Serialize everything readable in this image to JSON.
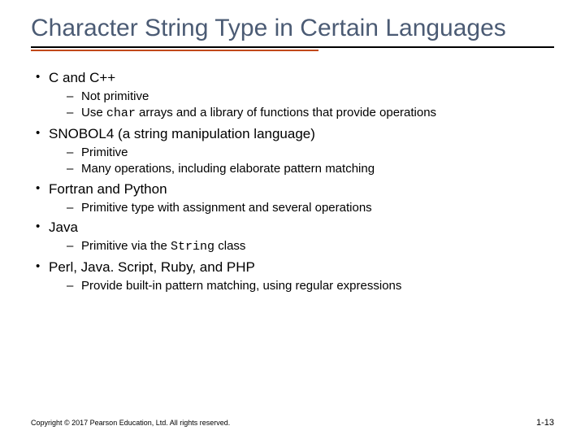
{
  "title": "Character String Type in Certain Languages",
  "bullets": {
    "b0": {
      "head": "C and C++",
      "s0": "Not primitive",
      "s1_pre": "Use ",
      "s1_code": "char",
      "s1_post": " arrays and a library of functions that provide operations"
    },
    "b1": {
      "head": "SNOBOL4 (a string manipulation language)",
      "s0": "Primitive",
      "s1": "Many operations, including elaborate pattern matching"
    },
    "b2": {
      "head": "Fortran and Python",
      "s0": "Primitive type with assignment and several operations"
    },
    "b3": {
      "head": "Java",
      "s0_pre": "Primitive via the ",
      "s0_code": "String",
      "s0_post": " class"
    },
    "b4": {
      "head": "Perl, Java. Script, Ruby, and PHP",
      "s0": "Provide built-in pattern matching, using regular expressions"
    }
  },
  "footer": {
    "copyright": "Copyright © 2017 Pearson Education, Ltd. All rights reserved.",
    "page": "1-13"
  }
}
